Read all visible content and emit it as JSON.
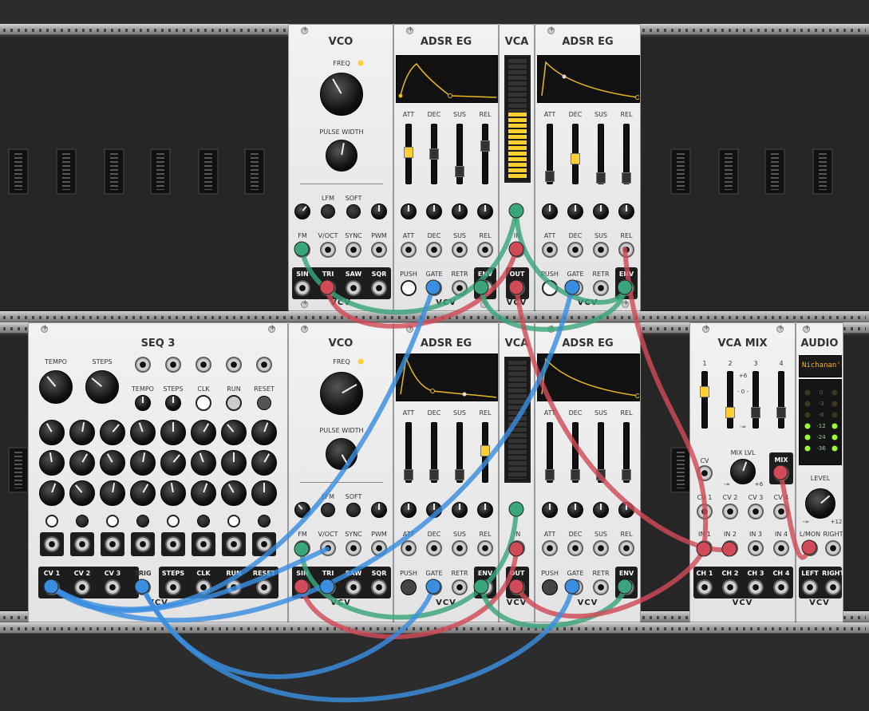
{
  "rows": [
    {
      "modules": [
        {
          "title": "VCO",
          "labels": [
            "FREQ",
            "PULSE WIDTH",
            "LFM",
            "SOFT",
            "FM",
            "V/OCT",
            "SYNC",
            "PWM"
          ],
          "outs": [
            "SIN",
            "TRI",
            "SAW",
            "SQR"
          ],
          "logo": "VCV"
        },
        {
          "title": "ADSR EG",
          "labels": [
            "ATT",
            "DEC",
            "SUS",
            "REL",
            "ATT",
            "DEC",
            "SUS",
            "REL",
            "PUSH"
          ],
          "outs": [
            "GATE",
            "RETR",
            "ENV"
          ],
          "logo": "VCV"
        },
        {
          "title": "VCA",
          "labels": [
            "IN",
            "OUT"
          ],
          "logo": "VCV"
        },
        {
          "title": "ADSR EG",
          "labels": [
            "ATT",
            "DEC",
            "SUS",
            "REL",
            "ATT",
            "DEC",
            "SUS",
            "REL",
            "PUSH"
          ],
          "outs": [
            "GATE",
            "RETR",
            "ENV"
          ],
          "logo": "VCV"
        }
      ]
    },
    {
      "modules": [
        {
          "title": "SEQ 3",
          "labels": [
            "TEMPO",
            "STEPS",
            "TEMPO",
            "STEPS",
            "CLK",
            "RUN",
            "RESET"
          ],
          "outs": [
            "CV 1",
            "CV 2",
            "CV 3",
            "TRIG",
            "STEPS",
            "CLK",
            "RUN",
            "RESET"
          ],
          "logo": "VCV"
        },
        {
          "title": "VCO",
          "labels": [
            "FREQ",
            "PULSE WIDTH",
            "LFM",
            "SOFT",
            "FM",
            "V/OCT",
            "SYNC",
            "PWM"
          ],
          "outs": [
            "SIN",
            "TRI",
            "SAW",
            "SQR"
          ],
          "logo": "VCV"
        },
        {
          "title": "ADSR EG",
          "labels": [
            "ATT",
            "DEC",
            "SUS",
            "REL",
            "ATT",
            "DEC",
            "SUS",
            "REL",
            "PUSH"
          ],
          "outs": [
            "GATE",
            "RETR",
            "ENV"
          ],
          "logo": "VCV"
        },
        {
          "title": "VCA",
          "labels": [
            "IN",
            "OUT"
          ],
          "logo": "VCV"
        },
        {
          "title": "ADSR EG",
          "labels": [
            "ATT",
            "DEC",
            "SUS",
            "REL",
            "ATT",
            "DEC",
            "SUS",
            "REL",
            "PUSH"
          ],
          "outs": [
            "GATE",
            "RETR",
            "ENV"
          ],
          "logo": "VCV"
        },
        {
          "title": "VCA MIX",
          "labels": [
            "1",
            "2",
            "3",
            "4",
            "+6",
            "- 0 -",
            "-∞",
            "CV",
            "MIX LVL",
            "-∞",
            "+6",
            "MIX",
            "CV 1",
            "CV 2",
            "CV 3",
            "CV 4",
            "IN 1",
            "IN 2",
            "IN 3",
            "IN 4"
          ],
          "outs": [
            "CH 1",
            "CH 2",
            "CH 3",
            "CH 4"
          ],
          "logo": "VCV"
        },
        {
          "title": "AUDIO",
          "device": "Nichanan's",
          "meter": [
            "0",
            "-3",
            "-6",
            "-12",
            "-24",
            "-36"
          ],
          "labels": [
            "LEVEL",
            "-∞",
            "+12",
            "L/MON",
            "RIGHT"
          ],
          "outs": [
            "LEFT",
            "RIGHT"
          ],
          "logo": "VCV"
        }
      ]
    }
  ],
  "colors": {
    "green": "#3aa57a",
    "red": "#d04a58",
    "blue": "#3a8ee0",
    "led_yellow": "#ffd030"
  }
}
